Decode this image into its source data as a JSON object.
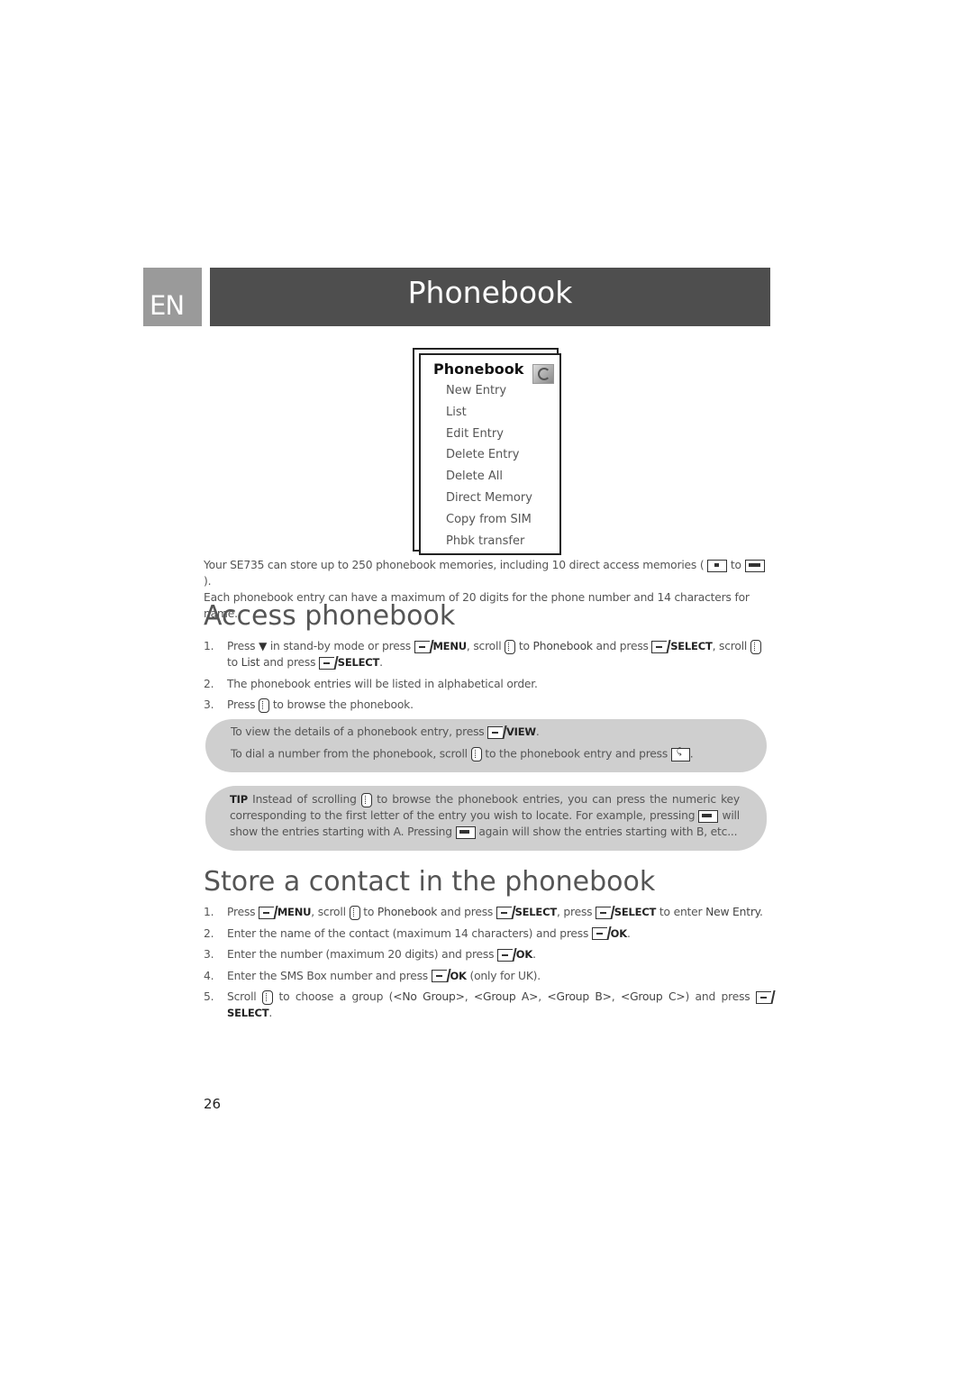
{
  "header": {
    "language_badge": "EN",
    "section_title": "Phonebook"
  },
  "phone_menu": {
    "title": "Phonebook",
    "icon": "phonebook-icon",
    "items": [
      "New Entry",
      "List",
      "Edit Entry",
      "Delete Entry",
      "Delete All",
      "Direct Memory",
      "Copy from SIM",
      "Phbk transfer"
    ]
  },
  "intro": {
    "line1_a": "Your SE735 can store up to 250 phonebook memories, including 10 direct access memories (",
    "line1_to": "to",
    "line1_b": ").",
    "line2": "Each phonebook entry can have a maximum of 20 digits for the phone number and 14 characters for name."
  },
  "access": {
    "heading": "Access phonebook",
    "steps": [
      {
        "num": "1.",
        "t1": "Press",
        "t2": "in stand-by mode or press",
        "menu": "MENU",
        "t3": ", scroll",
        "t4": "to",
        "phonebook": "Phonebook",
        "t5": "and press",
        "select": "SELECT",
        "t6": ", scroll",
        "t7": "to",
        "list": "List",
        "t8": "and press",
        "select2": "SELECT",
        "t9": "."
      },
      {
        "num": "2.",
        "text": "The phonebook entries will be listed in alphabetical order."
      },
      {
        "num": "3.",
        "t1": "Press",
        "t2": "to browse the phonebook."
      }
    ]
  },
  "note": {
    "line1_a": "To view the details of a phonebook entry, press",
    "line1_key": "VIEW",
    "line1_b": ".",
    "line2_a": "To dial a number from the phonebook, scroll",
    "line2_b": "to the phonebook entry and press",
    "line2_c": "."
  },
  "tip": {
    "label": "TIP",
    "t1": "Instead of scrolling",
    "t2": "to browse the phonebook entries, you can press the numeric key corresponding to the first letter of the entry you wish to locate. For example, pressing",
    "t3": "will show the entries starting with A. Pressing",
    "t4": "again will show the entries starting with B, etc..."
  },
  "store": {
    "heading": "Store a contact in the phonebook",
    "steps": [
      {
        "num": "1.",
        "t1": "Press",
        "menu": "MENU",
        "t2": ", scroll",
        "t3": "to",
        "phonebook": "Phonebook",
        "t4": "and press",
        "select": "SELECT",
        "t5": ", press",
        "select2": "SELECT",
        "t6": "to enter",
        "new_entry": "New Entry",
        "t7": "."
      },
      {
        "num": "2.",
        "t1": "Enter the name of the contact (maximum 14 characters) and press",
        "ok": "OK",
        "t2": "."
      },
      {
        "num": "3.",
        "t1": "Enter the number (maximum 20 digits) and press",
        "ok": "OK",
        "t2": "."
      },
      {
        "num": "4.",
        "t1": "Enter the SMS Box number and press",
        "ok": "OK",
        "t2": "(only for UK)."
      },
      {
        "num": "5.",
        "t1": "Scroll",
        "t2": "to choose a group (",
        "g1": "<No Group>",
        "g2": "<Group A>",
        "g3": "<Group B>",
        "g4": "<Group C>",
        "t3": ") and press",
        "select": "SELECT",
        "t4": "."
      }
    ]
  },
  "footer": {
    "page_number": "26"
  }
}
